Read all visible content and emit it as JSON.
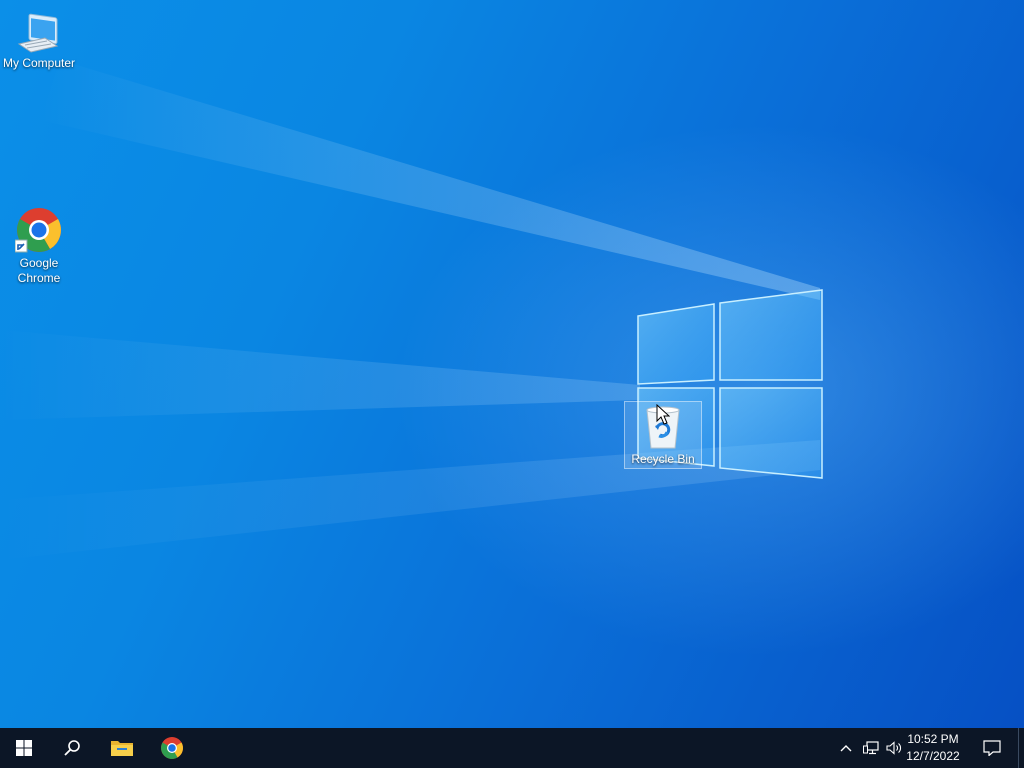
{
  "desktop": {
    "icons": [
      {
        "label": "My Computer",
        "icon": "computer-icon"
      },
      {
        "label": "Google Chrome",
        "icon": "chrome-icon",
        "shortcut": true
      },
      {
        "label": "Recycle Bin",
        "icon": "recycle-bin-icon",
        "selected": true
      }
    ]
  },
  "taskbar": {
    "start_icon": "windows-start-icon",
    "search_icon": "search-icon",
    "pinned": [
      {
        "icon": "file-explorer-icon"
      },
      {
        "icon": "chrome-icon"
      }
    ],
    "tray": {
      "icons": [
        "chevron-up-icon",
        "network-icon",
        "volume-icon"
      ],
      "time": "10:52 PM",
      "date": "12/7/2022",
      "notification_icon": "action-center-icon"
    }
  },
  "colors": {
    "wallpaper_light": "#0b8fe8",
    "wallpaper_dark": "#0650c4",
    "taskbar": "#0c1626"
  }
}
